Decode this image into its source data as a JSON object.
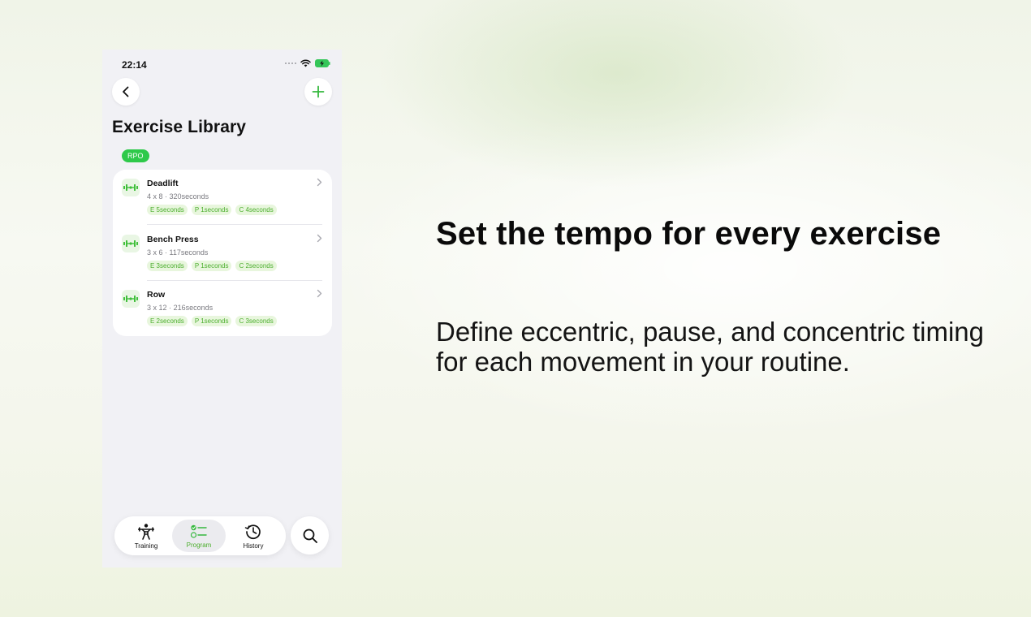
{
  "status_bar": {
    "time": "22:14"
  },
  "header": {
    "title": "Exercise Library",
    "badge": "RPO"
  },
  "exercises": [
    {
      "name": "Deadlift",
      "sets_reps": "4 x 8",
      "duration": "320seconds",
      "tempo": [
        "E 5seconds",
        "P 1seconds",
        "C 4seconds"
      ]
    },
    {
      "name": "Bench Press",
      "sets_reps": "3 x 6",
      "duration": "117seconds",
      "tempo": [
        "E 3seconds",
        "P 1seconds",
        "C 2seconds"
      ]
    },
    {
      "name": "Row",
      "sets_reps": "3 x 12",
      "duration": "216seconds",
      "tempo": [
        "E 2seconds",
        "P 1seconds",
        "C 3seconds"
      ]
    }
  ],
  "meta_separator": "·",
  "tabbar": {
    "tabs": [
      {
        "label": "Training",
        "icon": "weightlifter-icon",
        "active": false
      },
      {
        "label": "Program",
        "icon": "checklist-icon",
        "active": true
      },
      {
        "label": "History",
        "icon": "clock-history-icon",
        "active": false
      }
    ],
    "search_icon": "search-icon"
  },
  "marketing": {
    "headline": "Set the tempo for every exercise",
    "subcopy": "Define eccentric, pause, and concentric timing for each movement in your routine."
  },
  "colors": {
    "accent_green": "#2ec94a",
    "tag_bg": "#e8f6dd",
    "tag_text": "#4caf2e"
  }
}
